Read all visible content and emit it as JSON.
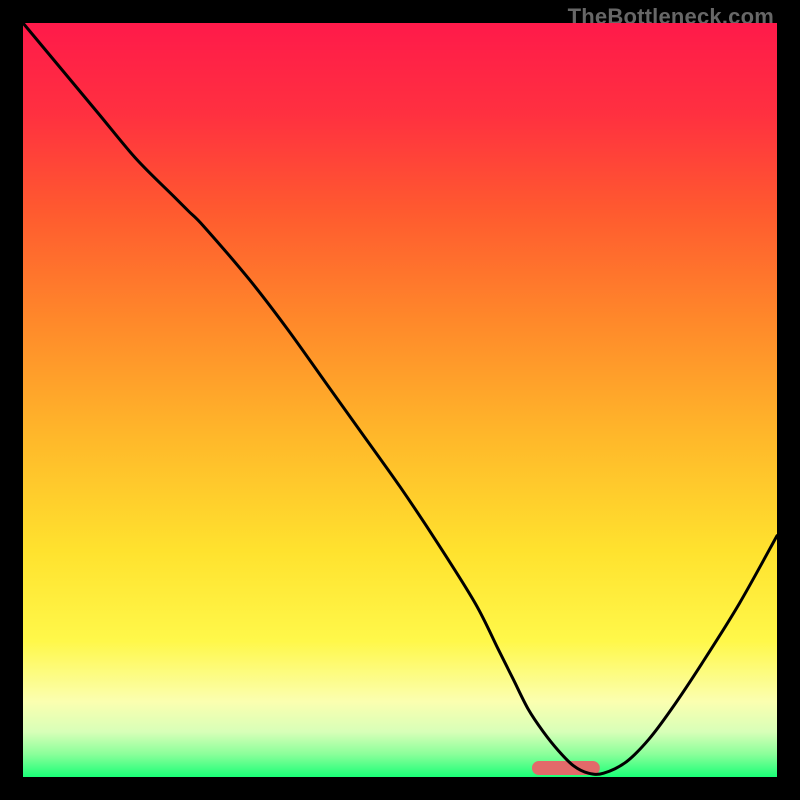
{
  "watermark": "TheBottleneck.com",
  "chart_data": {
    "type": "line",
    "title": "",
    "xlabel": "",
    "ylabel": "",
    "x_range": [
      0,
      100
    ],
    "y_range": [
      0,
      100
    ],
    "series": [
      {
        "name": "curve",
        "x": [
          0,
          5,
          10,
          15,
          20,
          22,
          24,
          30,
          35,
          40,
          45,
          50,
          55,
          60,
          63,
          65,
          67,
          69,
          71,
          73,
          75,
          77,
          80,
          83,
          86,
          90,
          95,
          100
        ],
        "values": [
          100,
          94,
          88,
          82,
          77,
          75,
          73,
          66,
          59.5,
          52.5,
          45.5,
          38.5,
          31,
          23,
          17,
          13,
          9,
          6,
          3.5,
          1.5,
          0.5,
          0.5,
          2,
          5,
          9,
          15,
          23,
          32
        ]
      }
    ],
    "optimal_marker": {
      "x_center": 72,
      "width": 9
    },
    "gradient_stops": [
      {
        "offset": 0,
        "color": "#ff1a4a"
      },
      {
        "offset": 12,
        "color": "#ff3040"
      },
      {
        "offset": 25,
        "color": "#ff5a2f"
      },
      {
        "offset": 40,
        "color": "#ff8a2a"
      },
      {
        "offset": 55,
        "color": "#ffb82a"
      },
      {
        "offset": 70,
        "color": "#ffe22e"
      },
      {
        "offset": 82,
        "color": "#fff84a"
      },
      {
        "offset": 90,
        "color": "#fbffb0"
      },
      {
        "offset": 94,
        "color": "#d8ffb8"
      },
      {
        "offset": 97,
        "color": "#8aff9a"
      },
      {
        "offset": 100,
        "color": "#1aff77"
      }
    ]
  }
}
